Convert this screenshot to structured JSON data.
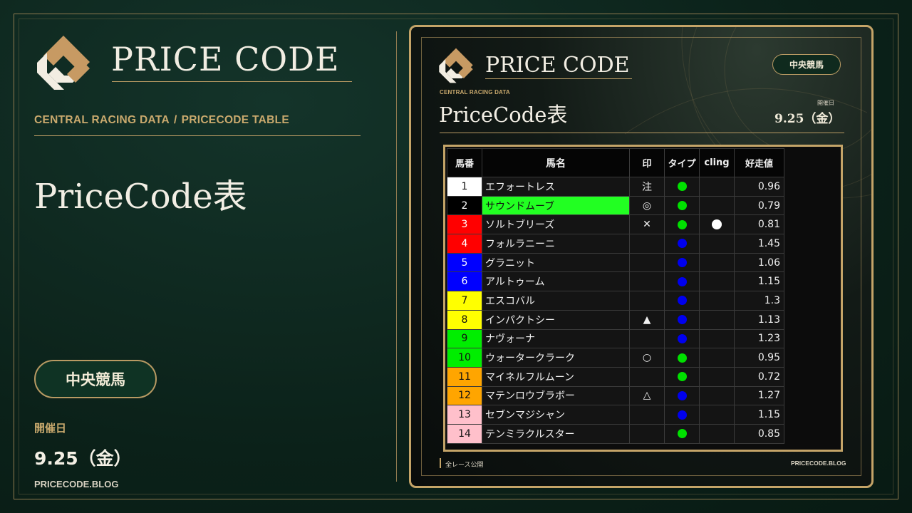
{
  "brand": {
    "name": "PRICE CODE"
  },
  "breadcrumb": {
    "section": "CENTRAL RACING DATA",
    "separator": "/",
    "page": "PRICECODE TABLE"
  },
  "page": {
    "title": "PriceCode表",
    "category_badge": "中央競馬",
    "date_label": "開催日",
    "date_value": "9.25（金）",
    "site": "PRICECODE.BLOG"
  },
  "card": {
    "brand": "PRICE CODE",
    "badge": "中央競馬",
    "subtitle": "CENTRAL RACING DATA",
    "title": "PriceCode表",
    "date_label": "開催日",
    "date_value": "9.25（金）",
    "footer_left": "全レース公開",
    "footer_right": "PRICECODE.BLOG"
  },
  "table": {
    "headers": [
      "馬番",
      "馬名",
      "印",
      "タイプ",
      "cling",
      "好走値"
    ],
    "rows": [
      {
        "num": "1",
        "name": "エフォートレス",
        "mark": "注",
        "type": "green",
        "cling": "",
        "value": "0.96",
        "gate_bg": "#ffffff",
        "gate_fg": "#111111",
        "name_highlight": false
      },
      {
        "num": "2",
        "name": "サウンドムーブ",
        "mark": "◎",
        "type": "green",
        "cling": "",
        "value": "0.79",
        "gate_bg": "#000000",
        "gate_fg": "#ffffff",
        "name_highlight": true
      },
      {
        "num": "3",
        "name": "ソルトブリーズ",
        "mark": "✕",
        "type": "green",
        "cling": "white",
        "value": "0.81",
        "gate_bg": "#ff0000",
        "gate_fg": "#ffffff",
        "name_highlight": false
      },
      {
        "num": "4",
        "name": "フォルラニーニ",
        "mark": "",
        "type": "blue",
        "cling": "",
        "value": "1.45",
        "gate_bg": "#ff0000",
        "gate_fg": "#ffffff",
        "name_highlight": false
      },
      {
        "num": "5",
        "name": "グラニット",
        "mark": "",
        "type": "blue",
        "cling": "",
        "value": "1.06",
        "gate_bg": "#0000ff",
        "gate_fg": "#ffffff",
        "name_highlight": false
      },
      {
        "num": "6",
        "name": "アルトゥーム",
        "mark": "",
        "type": "blue",
        "cling": "",
        "value": "1.15",
        "gate_bg": "#0000ff",
        "gate_fg": "#ffffff",
        "name_highlight": false
      },
      {
        "num": "7",
        "name": "エスコバル",
        "mark": "",
        "type": "blue",
        "cling": "",
        "value": "1.3",
        "gate_bg": "#ffff00",
        "gate_fg": "#111111",
        "name_highlight": false
      },
      {
        "num": "8",
        "name": "インパクトシー",
        "mark": "▲",
        "type": "blue",
        "cling": "",
        "value": "1.13",
        "gate_bg": "#ffff00",
        "gate_fg": "#111111",
        "name_highlight": false
      },
      {
        "num": "9",
        "name": "ナヴォーナ",
        "mark": "",
        "type": "blue",
        "cling": "",
        "value": "1.23",
        "gate_bg": "#00ee00",
        "gate_fg": "#111111",
        "name_highlight": false
      },
      {
        "num": "10",
        "name": "ウォータークラーク",
        "mark": "○",
        "type": "green",
        "cling": "",
        "value": "0.95",
        "gate_bg": "#00ee00",
        "gate_fg": "#111111",
        "name_highlight": false
      },
      {
        "num": "11",
        "name": "マイネルフルムーン",
        "mark": "",
        "type": "green",
        "cling": "",
        "value": "0.72",
        "gate_bg": "#ffa500",
        "gate_fg": "#111111",
        "name_highlight": false
      },
      {
        "num": "12",
        "name": "マテンロウブラボー",
        "mark": "△",
        "type": "blue",
        "cling": "",
        "value": "1.27",
        "gate_bg": "#ffa500",
        "gate_fg": "#111111",
        "name_highlight": false
      },
      {
        "num": "13",
        "name": "セブンマジシャン",
        "mark": "",
        "type": "blue",
        "cling": "",
        "value": "1.15",
        "gate_bg": "#ffc0cb",
        "gate_fg": "#111111",
        "name_highlight": false
      },
      {
        "num": "14",
        "name": "テンミラクルスター",
        "mark": "",
        "type": "green",
        "cling": "",
        "value": "0.85",
        "gate_bg": "#ffc0cb",
        "gate_fg": "#111111",
        "name_highlight": false
      }
    ]
  },
  "colors": {
    "gold": "#c4a468",
    "dot_green": "#00e000",
    "dot_blue": "#0000ee",
    "dot_white": "#ffffff",
    "highlight_green": "#22ff22"
  },
  "icons": {
    "logo": "pricecode-logo-icon",
    "type_dot": "circle-dot-icon"
  }
}
